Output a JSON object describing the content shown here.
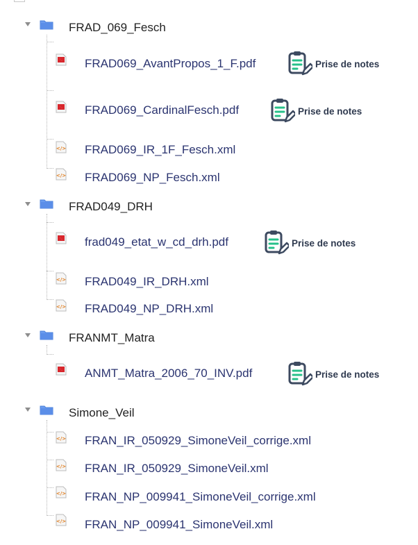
{
  "colors": {
    "folder": "#5b8ee8",
    "link": "#2b3470",
    "notes_icon": "#3d4a60",
    "notes_accent": "#27c08a"
  },
  "notes_label": "Prise de notes",
  "folders": [
    {
      "name": "FRAD_069_Fesch",
      "files": [
        {
          "name": "FRAD069_AvantPropos_1_F.pdf",
          "type": "pdf",
          "notes": true
        },
        {
          "name": "FRAD069_CardinalFesch.pdf",
          "type": "pdf",
          "notes": true
        },
        {
          "name": "FRAD069_IR_1F_Fesch.xml",
          "type": "xml",
          "notes": false
        },
        {
          "name": "FRAD069_NP_Fesch.xml",
          "type": "xml",
          "notes": false
        }
      ]
    },
    {
      "name": "FRAD049_DRH",
      "files": [
        {
          "name": "frad049_etat_w_cd_drh.pdf",
          "type": "pdf",
          "notes": true
        },
        {
          "name": "FRAD049_IR_DRH.xml",
          "type": "xml",
          "notes": false
        },
        {
          "name": "FRAD049_NP_DRH.xml",
          "type": "xml",
          "notes": false
        }
      ]
    },
    {
      "name": "FRANMT_Matra",
      "files": [
        {
          "name": "ANMT_Matra_2006_70_INV.pdf",
          "type": "pdf",
          "notes": true
        }
      ]
    },
    {
      "name": "Simone_Veil",
      "files": [
        {
          "name": "FRAN_IR_050929_SimoneVeil_corrige.xml",
          "type": "xml",
          "notes": false
        },
        {
          "name": "FRAN_IR_050929_SimoneVeil.xml",
          "type": "xml",
          "notes": false
        },
        {
          "name": "FRAN_NP_009941_SimoneVeil_corrige.xml",
          "type": "xml",
          "notes": false
        },
        {
          "name": "FRAN_NP_009941_SimoneVeil.xml",
          "type": "xml",
          "notes": false
        }
      ]
    }
  ]
}
